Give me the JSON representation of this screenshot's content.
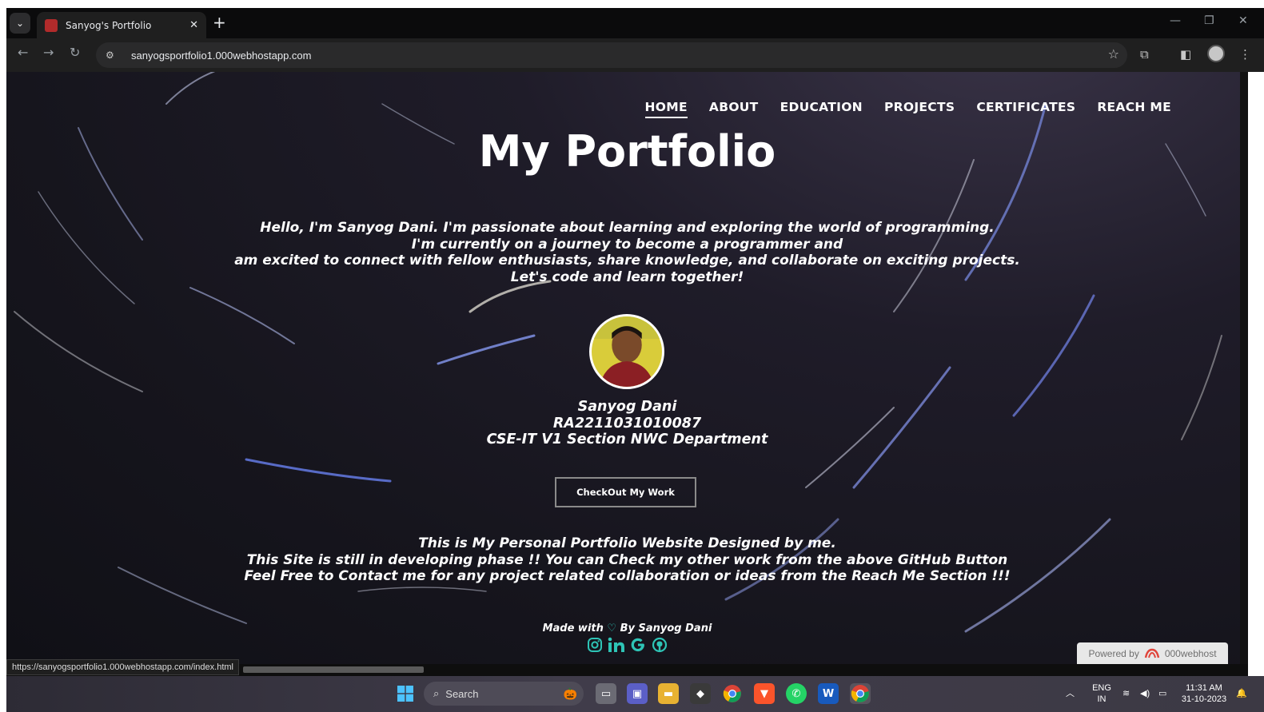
{
  "browser": {
    "tab_title": "Sanyog's Portfolio",
    "tab_close": "✕",
    "new_tab": "+",
    "url": "sanyogsportfolio1.000webhostapp.com",
    "status_url": "https://sanyogsportfolio1.000webhostapp.com/index.html"
  },
  "site": {
    "nav": [
      "HOME",
      "ABOUT",
      "EDUCATION",
      "PROJECTS",
      "CERTIFICATES",
      "REACH ME"
    ],
    "active_nav": "HOME",
    "title": "My Portfolio",
    "intro": {
      "line1": "Hello, I'm Sanyog Dani. I'm passionate about learning and exploring the world of programming.",
      "line2": "I'm currently on a journey to become a programmer and",
      "line3": "am excited to connect with fellow enthusiasts, share knowledge, and collaborate on exciting projects.",
      "line4": "Let's code and learn together!"
    },
    "profile": {
      "name": "Sanyog Dani",
      "reg_no": "RA2211031010087",
      "section": "CSE-IT V1 Section NWC Department"
    },
    "cta_label": "CheckOut My Work",
    "notes": {
      "line1": "This is My Personal Portfolio Website Designed by me.",
      "line2": "This Site is still in developing phase !! You can Check my other work from the above GitHub Button",
      "line3": "Feel Free to Contact me for any project related collaboration or ideas from the Reach Me Section !!!"
    },
    "footer": {
      "made_with": "Made with",
      "by": "By Sanyog Dani"
    },
    "socials": [
      "instagram-icon",
      "linkedin-icon",
      "google-icon",
      "github-icon"
    ],
    "accent_color": "#2ec4b6",
    "powered_by": {
      "label": "Powered by",
      "brand": "000webhost"
    }
  },
  "taskbar": {
    "search_placeholder": "Search",
    "lang_top": "ENG",
    "lang_bottom": "IN",
    "time": "11:31 AM",
    "date": "31-10-2023"
  }
}
